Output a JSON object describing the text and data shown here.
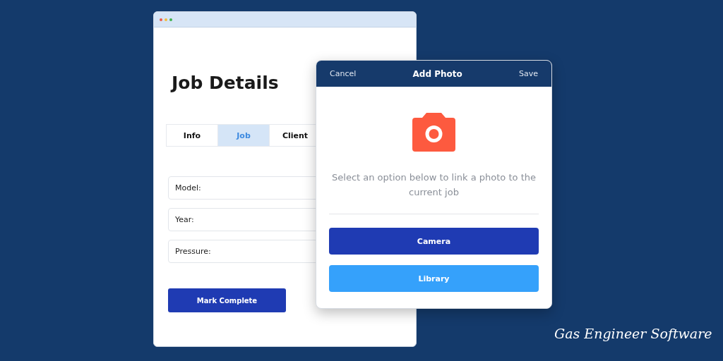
{
  "job_window": {
    "title": "Job Details",
    "tabs": [
      {
        "label": "Info",
        "selected": false
      },
      {
        "label": "Job",
        "selected": true
      },
      {
        "label": "Client",
        "selected": false
      }
    ],
    "fields": [
      {
        "label": "Model:"
      },
      {
        "label": "Year:"
      },
      {
        "label": "Pressure:"
      }
    ],
    "button": "Mark Complete"
  },
  "dialog": {
    "cancel": "Cancel",
    "title": "Add Photo",
    "save": "Save",
    "message": "Select an option below to link a photo to the current job",
    "buttons": [
      {
        "label": "Camera",
        "kind": "primary"
      },
      {
        "label": "Library",
        "kind": "secondary"
      }
    ]
  },
  "brand": "Gas Engineer Software"
}
